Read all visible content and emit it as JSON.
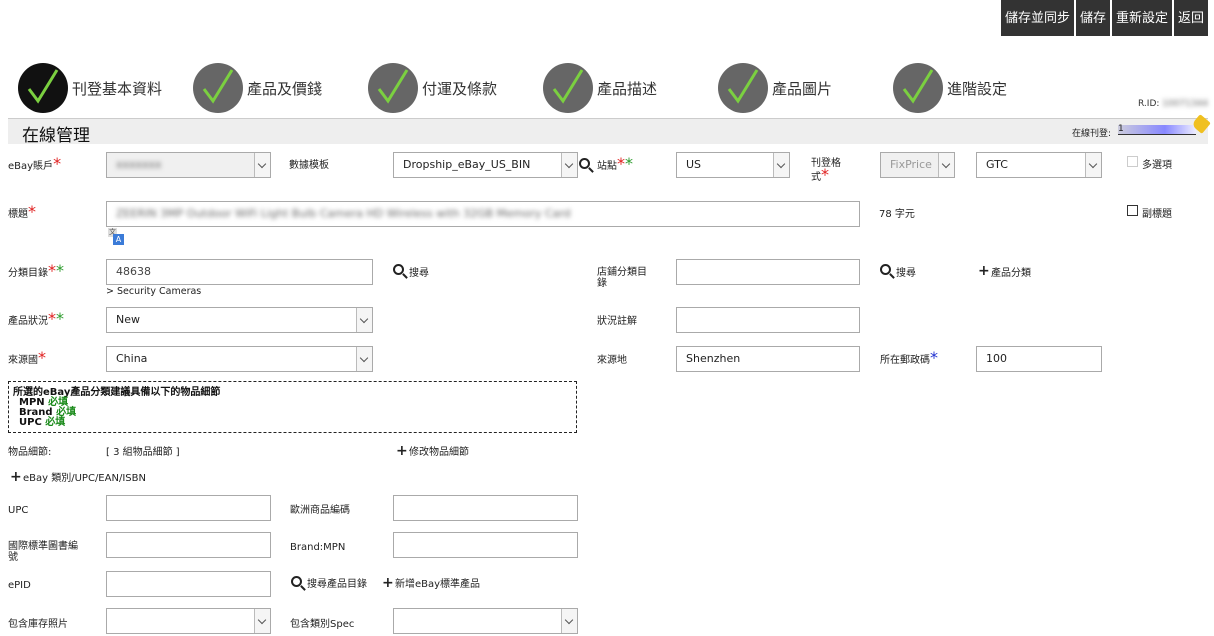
{
  "top_buttons": [
    "儲存並同步",
    "儲存",
    "重新設定",
    "返回"
  ],
  "steps": [
    "刊登基本資料",
    "產品及價錢",
    "付運及條款",
    "產品描述",
    "產品圖片",
    "進階設定"
  ],
  "rid_label": "R.ID:",
  "section_title": "在線管理",
  "online_label": "在線刊登:",
  "online_link": "1",
  "labels": {
    "ebay_account": "eBay賬戶",
    "template": "數據模板",
    "site": "站點",
    "listing_format": "刊登格式",
    "multi_option": "多選項",
    "title": "標題",
    "char_count": "78 字元",
    "subtitle": "副標題",
    "category": "分類目錄",
    "search": "搜尋",
    "store_category": "店鋪分類目錄",
    "add_category": "產品分類",
    "category_path": "> Security Cameras",
    "condition": "產品狀況",
    "condition_note": "狀況註解",
    "country": "來源國",
    "location": "來源地",
    "postcode": "所在郵政碼",
    "item_specifics": "物品細節",
    "item_specifics_count": "[ 3 組物品細節 ]",
    "edit_specifics": "修改物品細節",
    "ebay_upc": "eBay 類別/UPC/EAN/ISBN",
    "upc": "UPC",
    "ean": "歐洲商品編碼",
    "isbn": "國際標準圖書編號",
    "brand_mpn": "Brand:MPN",
    "epid": "ePID",
    "search_catalog": "搜尋產品目錄",
    "add_standard": "新增eBay標準產品",
    "include_photos": "包含庫存照片",
    "include_spec": "包含類別Spec"
  },
  "values": {
    "ebay_account": "xxxxxxx",
    "template": "Dropship_eBay_US_BIN",
    "site": "US",
    "format": "FixPrice",
    "duration": "GTC",
    "title": "ZEERIN 3MP Outdoor WiFi Light Bulb Camera HD Wireless with 32GB Memory Card",
    "category": "48638",
    "condition": "New",
    "country": "China",
    "location": "Shenzhen",
    "postcode": "100"
  },
  "specifics_box": {
    "heading": "所選的eBay產品分類建議具備以下的物品細節",
    "items": [
      {
        "name": "MPN",
        "tag": "必填"
      },
      {
        "name": "Brand",
        "tag": "必填"
      },
      {
        "name": "UPC",
        "tag": "必填"
      }
    ]
  }
}
